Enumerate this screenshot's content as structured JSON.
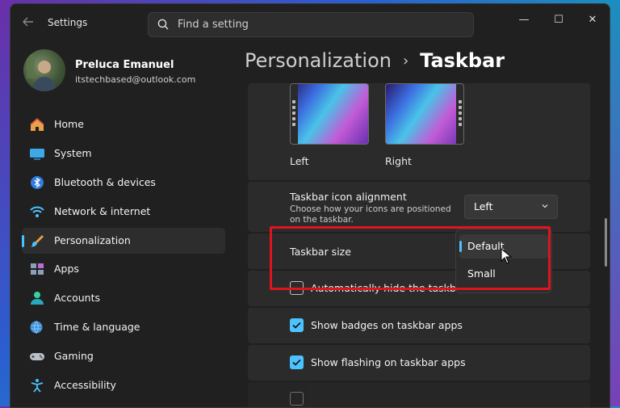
{
  "window": {
    "title": "Settings",
    "search_placeholder": "Find a setting",
    "controls": {
      "minimize": "—",
      "maximize": "☐",
      "close": "✕"
    }
  },
  "profile": {
    "name": "Preluca Emanuel",
    "email": "itstechbased@outlook.com"
  },
  "nav": [
    {
      "label": "Home",
      "icon": "home-icon",
      "active": false
    },
    {
      "label": "System",
      "icon": "system-icon",
      "active": false
    },
    {
      "label": "Bluetooth & devices",
      "icon": "bluetooth-icon",
      "active": false
    },
    {
      "label": "Network & internet",
      "icon": "wifi-icon",
      "active": false
    },
    {
      "label": "Personalization",
      "icon": "brush-icon",
      "active": true
    },
    {
      "label": "Apps",
      "icon": "apps-icon",
      "active": false
    },
    {
      "label": "Accounts",
      "icon": "account-icon",
      "active": false
    },
    {
      "label": "Time & language",
      "icon": "globe-icon",
      "active": false
    },
    {
      "label": "Gaming",
      "icon": "gamepad-icon",
      "active": false
    },
    {
      "label": "Accessibility",
      "icon": "accessibility-icon",
      "active": false
    }
  ],
  "breadcrumb": {
    "parent": "Personalization",
    "separator": "›",
    "current": "Taskbar"
  },
  "alignment_thumbs": {
    "left_label": "Left",
    "right_label": "Right"
  },
  "icon_alignment": {
    "title": "Taskbar icon alignment",
    "description": "Choose how your icons are positioned on the taskbar.",
    "value": "Left"
  },
  "taskbar_size": {
    "title": "Taskbar size",
    "options": [
      "Default",
      "Small"
    ],
    "selected": "Default"
  },
  "checkboxes": [
    {
      "label": "Automatically hide the taskbar",
      "checked": false
    },
    {
      "label": "Show badges on taskbar apps",
      "checked": true
    },
    {
      "label": "Show flashing on taskbar apps",
      "checked": true
    }
  ],
  "colors": {
    "accent": "#4cc2ff",
    "highlight": "#e0141e",
    "window_bg": "#202020",
    "card_bg": "#2b2b2b"
  }
}
